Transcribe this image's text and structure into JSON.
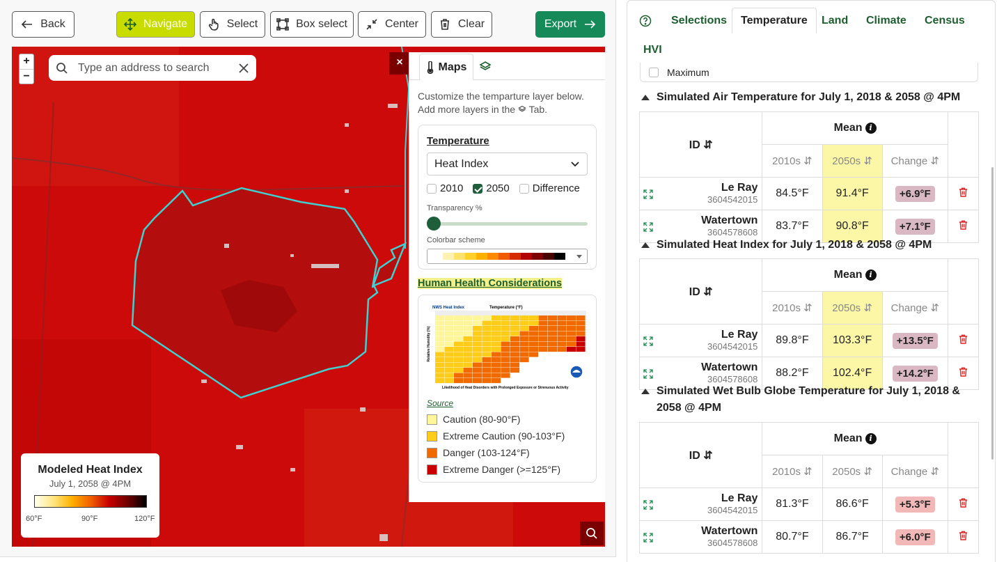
{
  "toolbar": {
    "back": "Back",
    "navigate": "Navigate",
    "select": "Select",
    "box_select": "Box select",
    "center": "Center",
    "clear": "Clear",
    "export": "Export"
  },
  "map": {
    "search_placeholder": "Type an address to search",
    "zoom_in": "+",
    "zoom_out": "−",
    "close": "×"
  },
  "layer_panel": {
    "tab_maps": "Maps",
    "intro": "Customize the temparture layer below. Add more layers in the",
    "intro_tab": "Tab.",
    "section": "Temperature",
    "dropdown_value": "Heat Index",
    "chk_2010": "2010",
    "chk_2050": "2050",
    "chk_diff": "Difference",
    "chk_2010_on": false,
    "chk_2050_on": true,
    "chk_diff_on": false,
    "transparency_label": "Transparency %",
    "transparency_value": 0,
    "colorbar_label": "Colorbar scheme",
    "colorbar_colors": [
      "#ffffff",
      "#fff2b0",
      "#ffe36a",
      "#ffcf2a",
      "#ffb000",
      "#ff8a00",
      "#f05a00",
      "#d62a00",
      "#b30000",
      "#800000",
      "#4a0000",
      "#000000"
    ],
    "hhc": "Human Health Considerations",
    "source": "Source",
    "legend": [
      {
        "label": "Caution (80-90°F)",
        "color": "#fff59a"
      },
      {
        "label": "Extreme Caution (90-103°F)",
        "color": "#ffcc1a"
      },
      {
        "label": "Danger (103-124°F)",
        "color": "#f06a00"
      },
      {
        "label": "Extreme Danger (>=125°F)",
        "color": "#c80000"
      }
    ],
    "chart_title": "NWS Heat Index",
    "chart_axis": "Temperature (°F)",
    "chart_ylabel": "Relative Humidity (%)",
    "chart_footer": "Likelihood of Heat Disorders with Prolonged Exposure or Strenuous Activity"
  },
  "map_legend": {
    "title": "Modeled Heat Index",
    "subtitle": "July 1, 2058 @ 4PM",
    "min": "60°F",
    "mid": "90°F",
    "max": "120°F"
  },
  "right_tabs": {
    "selections": "Selections",
    "temperature": "Temperature",
    "land": "Land",
    "climate": "Climate",
    "census": "Census",
    "hvi": "HVI"
  },
  "maximum": "Maximum",
  "id_header": "ID",
  "mean_header": "Mean",
  "col_2010": "2010s",
  "col_2050": "2050s",
  "col_change": "Change",
  "sections": [
    {
      "title": "Simulated Air Temperature for July 1, 2018 & 2058 @ 4PM",
      "highlight": true,
      "rows": [
        {
          "name": "Le Ray",
          "code": "3604542015",
          "v2010": "84.5°F",
          "v2050": "91.4°F",
          "change": "+6.9°F",
          "badge": "#d9b8c4"
        },
        {
          "name": "Watertown",
          "code": "3604578608",
          "v2010": "83.7°F",
          "v2050": "90.8°F",
          "change": "+7.1°F",
          "badge": "#d9b8c4"
        }
      ]
    },
    {
      "title": "Simulated Heat Index for July 1, 2018 & 2058 @ 4PM",
      "highlight": true,
      "rows": [
        {
          "name": "Le Ray",
          "code": "3604542015",
          "v2010": "89.8°F",
          "v2050": "103.3°F",
          "change": "+13.5°F",
          "badge": "#d9b8c4"
        },
        {
          "name": "Watertown",
          "code": "3604578608",
          "v2010": "88.2°F",
          "v2050": "102.4°F",
          "change": "+14.2°F",
          "badge": "#d9b8c4"
        }
      ]
    },
    {
      "title": "Simulated Wet Bulb Globe Temperature for July 1, 2018 & 2058 @ 4PM",
      "highlight": false,
      "rows": [
        {
          "name": "Le Ray",
          "code": "3604542015",
          "v2010": "81.3°F",
          "v2050": "86.6°F",
          "change": "+5.3°F",
          "badge": "#f2b8b8"
        },
        {
          "name": "Watertown",
          "code": "3604578608",
          "v2010": "80.7°F",
          "v2050": "86.7°F",
          "change": "+6.0°F",
          "badge": "#f2b8b8"
        }
      ]
    }
  ]
}
